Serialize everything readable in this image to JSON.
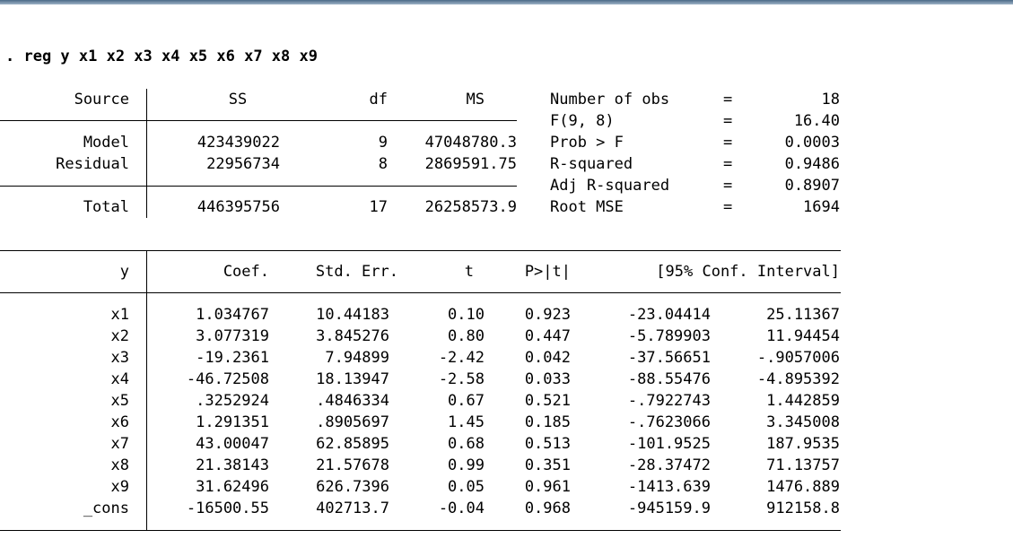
{
  "command": ". reg y x1 x2 x3 x4 x5 x6 x7 x8 x9",
  "anova": {
    "headers": {
      "source": "Source",
      "ss": "SS",
      "df": "df",
      "ms": "MS"
    },
    "rows": [
      {
        "source": "Model",
        "ss": "423439022",
        "df": "9",
        "ms": "47048780.3"
      },
      {
        "source": "Residual",
        "ss": "22956734",
        "df": "8",
        "ms": "2869591.75"
      },
      {
        "source": "Total",
        "ss": "446395756",
        "df": "17",
        "ms": "26258573.9"
      }
    ]
  },
  "stats": [
    {
      "label": "Number of obs",
      "eq": "=",
      "value": "18"
    },
    {
      "label": "F(9, 8)",
      "eq": "=",
      "value": "16.40"
    },
    {
      "label": "Prob > F",
      "eq": "=",
      "value": "0.0003"
    },
    {
      "label": "R-squared",
      "eq": "=",
      "value": "0.9486"
    },
    {
      "label": "Adj R-squared",
      "eq": "=",
      "value": "0.8907"
    },
    {
      "label": "Root MSE",
      "eq": "=",
      "value": "1694"
    }
  ],
  "coef_table": {
    "headers": {
      "var": "y",
      "coef": "Coef.",
      "se": "Std. Err.",
      "t": "t",
      "p": "P>|t|",
      "ci": "[95% Conf. Interval]"
    },
    "rows": [
      {
        "var": "x1",
        "coef": "1.034767",
        "se": "10.44183",
        "t": "0.10",
        "p": "0.923",
        "lo": "-23.04414",
        "hi": "25.11367"
      },
      {
        "var": "x2",
        "coef": "3.077319",
        "se": "3.845276",
        "t": "0.80",
        "p": "0.447",
        "lo": "-5.789903",
        "hi": "11.94454"
      },
      {
        "var": "x3",
        "coef": "-19.2361",
        "se": "7.94899",
        "t": "-2.42",
        "p": "0.042",
        "lo": "-37.56651",
        "hi": "-.9057006"
      },
      {
        "var": "x4",
        "coef": "-46.72508",
        "se": "18.13947",
        "t": "-2.58",
        "p": "0.033",
        "lo": "-88.55476",
        "hi": "-4.895392"
      },
      {
        "var": "x5",
        "coef": ".3252924",
        "se": ".4846334",
        "t": "0.67",
        "p": "0.521",
        "lo": "-.7922743",
        "hi": "1.442859"
      },
      {
        "var": "x6",
        "coef": "1.291351",
        "se": ".8905697",
        "t": "1.45",
        "p": "0.185",
        "lo": "-.7623066",
        "hi": "3.345008"
      },
      {
        "var": "x7",
        "coef": "43.00047",
        "se": "62.85895",
        "t": "0.68",
        "p": "0.513",
        "lo": "-101.9525",
        "hi": "187.9535"
      },
      {
        "var": "x8",
        "coef": "21.38143",
        "se": "21.57678",
        "t": "0.99",
        "p": "0.351",
        "lo": "-28.37472",
        "hi": "71.13757"
      },
      {
        "var": "x9",
        "coef": "31.62496",
        "se": "626.7396",
        "t": "0.05",
        "p": "0.961",
        "lo": "-1413.639",
        "hi": "1476.889"
      },
      {
        "var": "_cons",
        "coef": "-16500.55",
        "se": "402713.7",
        "t": "-0.04",
        "p": "0.968",
        "lo": "-945159.9",
        "hi": "912158.8"
      }
    ]
  }
}
